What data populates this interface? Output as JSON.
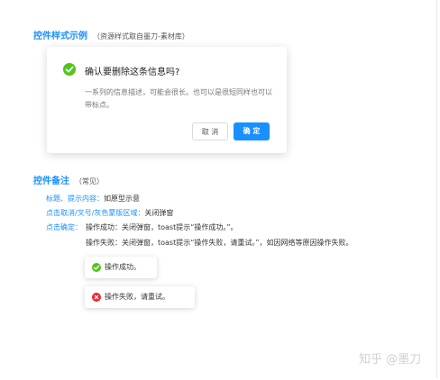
{
  "section1": {
    "title": "控件样式示例",
    "subtitle": "（资源样式取自墨刀-素材库）"
  },
  "dialog": {
    "title": "确认要删除这条信息吗?",
    "description": "一系列的信息描述，可能会很长。也可以是很短同样也可以带标点。",
    "cancel_label": "取 消",
    "ok_label": "确 定"
  },
  "section2": {
    "title": "控件备注",
    "subtitle": "（常见）"
  },
  "notes": {
    "title_label": "标题、提示内容：",
    "title_value": "如原型示意",
    "close_label": "点击取消/叉号/灰色蒙版区域：",
    "close_value": "关闭弹窗",
    "confirm_label": "点击确定：",
    "confirm_success": "操作成功：关闭弹窗，toast提示“操作成功。”。",
    "confirm_fail": "操作失败：关闭弹窗，toast提示“操作失败，请重试。”，如因网络等原因操作失败。"
  },
  "toasts": {
    "success": "操作成功。",
    "error": "操作失败，请重试。"
  },
  "watermark": "知乎 @墨刀",
  "colors": {
    "accent": "#1890ff",
    "success": "#52c41a",
    "error": "#f5222d"
  }
}
